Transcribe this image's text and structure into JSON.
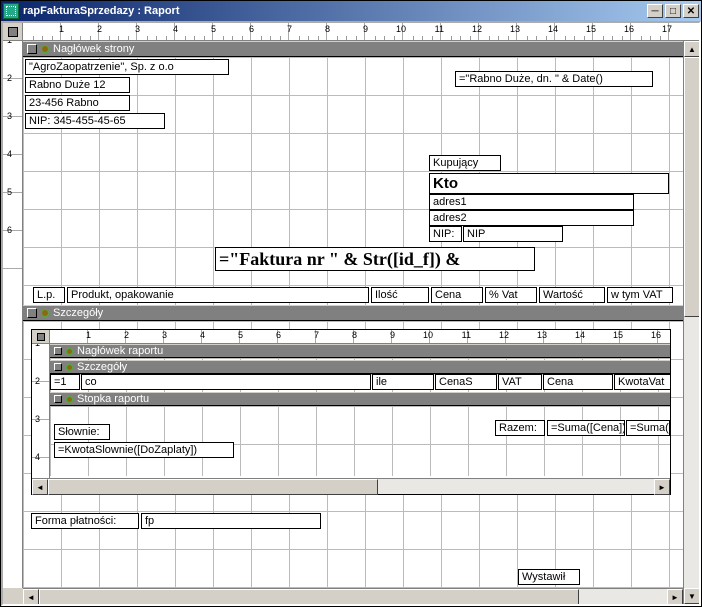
{
  "window": {
    "title": "rapFakturaSprzedazy : Raport"
  },
  "ruler_ticks": [
    "1",
    "2",
    "3",
    "4",
    "5",
    "6",
    "7",
    "8",
    "9",
    "10",
    "11",
    "12",
    "13",
    "14",
    "15",
    "16",
    "17"
  ],
  "vruler_ticks": [
    "1",
    "2",
    "3",
    "4",
    "5",
    "6"
  ],
  "sections": {
    "pageHeader": {
      "label": "Nagłówek strony",
      "companyName": "\"AgroZaopatrzenie\", Sp. z o.o",
      "addr1": "Rabno Duże 12",
      "addr2": "23-456 Rabno",
      "nip": "NIP: 345-455-45-65",
      "dateExpr": "=\"Rabno Duże, dn. \" & Date()",
      "buyerLabel": "Kupujący",
      "buyerName": "Kto",
      "buyerAddr1": "adres1",
      "buyerAddr2": "adres2",
      "buyerNipLabel": "NIP:",
      "buyerNipField": "NIP",
      "invoiceTitle": "=\"Faktura nr \" & Str([id_f]) & ",
      "col_lp": "L.p.",
      "col_product": "Produkt, opakowanie",
      "col_qty": "Ilość",
      "col_price": "Cena",
      "col_vat": "% Vat",
      "col_value": "Wartość",
      "col_vatAmount": "w tym VAT"
    },
    "detail": {
      "label": "Szczegóły"
    },
    "sub": {
      "reportHeader": {
        "label": "Nagłówek raportu"
      },
      "detail": {
        "label": "Szczegóły",
        "f_eq1": "=1",
        "f_co": "co",
        "f_ile": "ile",
        "f_cenaS": "CenaS",
        "f_vat": "VAT",
        "f_cena": "Cena",
        "f_kwotavat": "KwotaVat"
      },
      "reportFooter": {
        "label": "Stopka raportu",
        "razem": "Razem:",
        "sumaCena": "=Suma([Cena])",
        "sumaKwota": "=Suma([Kwo",
        "slownieLabel": "Słownie:",
        "slownieExpr": "=KwotaSlownie([DoZaplaty])"
      },
      "ruler": [
        "1",
        "2",
        "3",
        "4",
        "5",
        "6",
        "7",
        "8",
        "9",
        "10",
        "11",
        "12",
        "13",
        "14",
        "15",
        "16"
      ],
      "vruler": [
        "1",
        "2",
        "3",
        "4"
      ]
    },
    "payment": {
      "label": "Forma płatności:",
      "field": "fp"
    },
    "signer": {
      "label": "Wystawił"
    }
  }
}
